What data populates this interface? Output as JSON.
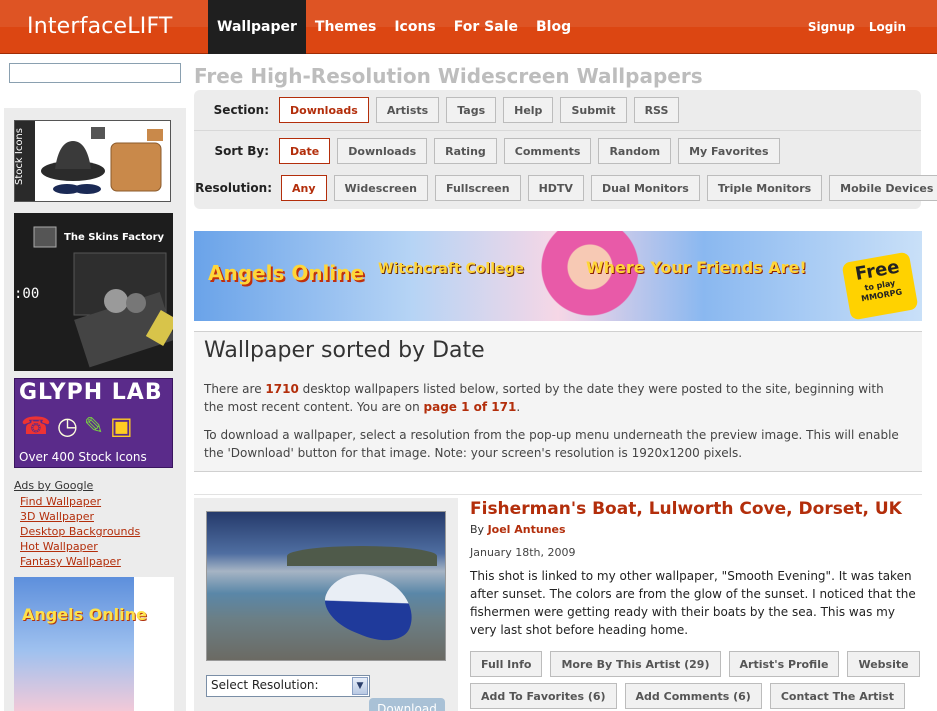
{
  "header": {
    "logo": "InterfaceLIFT",
    "nav": [
      "Wallpaper",
      "Themes",
      "Icons",
      "For Sale",
      "Blog"
    ],
    "active_nav": "Wallpaper",
    "user_links": [
      "Signup",
      "Login"
    ]
  },
  "sidebar": {
    "search_value": "",
    "ad_stock_label": "Stock Icons",
    "ad_skins_title": "The Skins Factory",
    "ad_skins_clock": ":00",
    "ad_glyph_title": "GLYPH LAB",
    "ad_glyph_sub": "Over 400 Stock Icons",
    "ads_google_title": "Ads by Google",
    "ads_google_links": [
      "Find Wallpaper",
      "3D Wallpaper",
      "Desktop Backgrounds",
      "Hot Wallpaper",
      "Fantasy Wallpaper"
    ],
    "ad_angels_logo": "Angels Online"
  },
  "main": {
    "heading": "Free High-Resolution Widescreen Wallpapers",
    "filters": {
      "section_label": "Section:",
      "section": [
        "Downloads",
        "Artists",
        "Tags",
        "Help",
        "Submit",
        "RSS"
      ],
      "section_active": "Downloads",
      "sort_label": "Sort By:",
      "sort": [
        "Date",
        "Downloads",
        "Rating",
        "Comments",
        "Random",
        "My Favorites"
      ],
      "sort_active": "Date",
      "res_label": "Resolution:",
      "res": [
        "Any",
        "Widescreen",
        "Fullscreen",
        "HDTV",
        "Dual Monitors",
        "Triple Monitors",
        "Mobile Devices"
      ],
      "res_active": "Any"
    },
    "banner": {
      "t1": "Angels Online",
      "t2": "Witchcraft College",
      "t3": "Where Your Friends Are!",
      "t4": "Free",
      "t4_small": "to play MMORPG"
    },
    "intro": {
      "title": "Wallpaper sorted by Date",
      "p1_a": "There are ",
      "count": "1710",
      "p1_b": " desktop wallpapers listed below, sorted by the date they were posted to the site, beginning with the most recent content. You are on ",
      "page": "page 1 of 171",
      "p1_c": ".",
      "p2": "To download a wallpaper, select a resolution from the pop-up menu underneath the preview image. This will enable the 'Download' button for that image. Note: your screen's resolution is 1920x1200 pixels."
    },
    "wallpaper": {
      "title": "Fisherman's Boat, Lulworth Cove, Dorset, UK",
      "by": "By ",
      "author": "Joel Antunes",
      "date": "January 18th, 2009",
      "description": "This shot is linked to my other wallpaper, \"Smooth Evening\". It was taken after sunset. The colors are from the glow of the sunset. I noticed that the fishermen were getting ready with their boats by the sea. This was my very last shot before heading home.",
      "select_placeholder": "Select Resolution:",
      "download_label": "Download",
      "actions_row1": [
        "Full Info",
        "More By This Artist (29)",
        "Artist's Profile",
        "Website"
      ],
      "actions_row2": [
        "Add To Favorites (6)",
        "Add Comments (6)",
        "Contact The Artist"
      ]
    }
  }
}
